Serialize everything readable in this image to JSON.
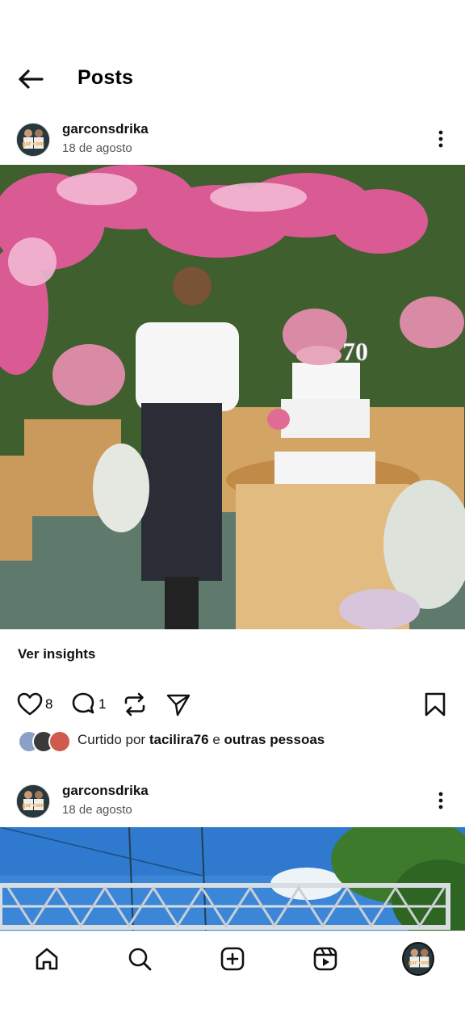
{
  "header": {
    "title": "Posts",
    "back_icon": "arrow-left-icon"
  },
  "posts": [
    {
      "username": "garconsdrika",
      "date": "18 de agosto",
      "avatar_text": "gar com",
      "image_badge": "70",
      "insights_label": "Ver insights",
      "likes": "8",
      "comments": "1",
      "liked_by_prefix": "Curtido por",
      "liked_by_user": "tacilira76",
      "liked_by_mid": "e",
      "liked_by_suffix": "outras pessoas"
    },
    {
      "username": "garconsdrika",
      "date": "18 de agosto",
      "avatar_text": "gar com"
    }
  ],
  "bottom_nav": [
    "home-icon",
    "search-icon",
    "create-icon",
    "reels-icon",
    "profile-avatar"
  ],
  "colors": {
    "accent": "#111111",
    "secondary_text": "#555555"
  }
}
